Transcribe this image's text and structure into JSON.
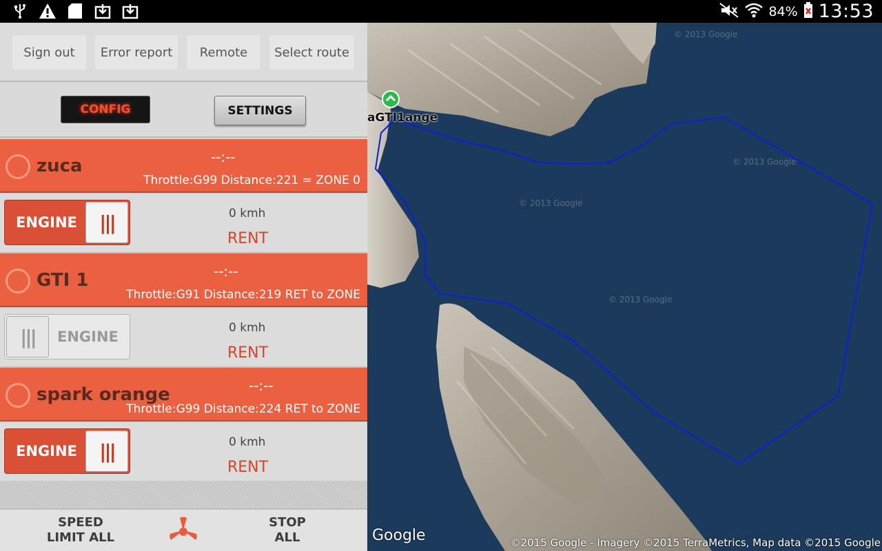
{
  "status_bar": {
    "icons": [
      "usb-icon",
      "warning-icon",
      "sd-card-icon",
      "download-icon",
      "download-icon"
    ],
    "battery_percent": "84%",
    "time": "13:53"
  },
  "toolbar": {
    "sign_out": "Sign out",
    "error_report": "Error report",
    "remote": "Remote",
    "select_route": "Select route"
  },
  "config": {
    "config_label": "CONFIG",
    "settings_label": "SETTINGS"
  },
  "vehicles": [
    {
      "name": "zuca",
      "time": "--:--",
      "throttle": "Throttle:G99 Distance:221 = ZONE 0",
      "engine_label": "ENGINE",
      "engine_on": true,
      "speed": "0 kmh",
      "status": "RENT"
    },
    {
      "name": "GTI 1",
      "time": "--:--",
      "throttle": "Throttle:G91 Distance:219 RET to ZONE",
      "engine_label": "ENGINE",
      "engine_on": false,
      "speed": "0 kmh",
      "status": "RENT"
    },
    {
      "name": "spark orange",
      "time": "--:--",
      "throttle": "Throttle:G99 Distance:224 RET to ZONE",
      "engine_label": "ENGINE",
      "engine_on": true,
      "speed": "0 kmh",
      "status": "RENT"
    }
  ],
  "bottom_bar": {
    "speed_limit_line1": "SPEED",
    "speed_limit_line2": "LIMIT ALL",
    "center_icon": "propeller-icon",
    "stop_line1": "STOP",
    "stop_line2": "ALL"
  },
  "map": {
    "marker_label": "aGTI1ange",
    "logo": "Google",
    "attribution": "©2015 Google - Imagery ©2015 TerraMetrics, Map data ©2015 Google",
    "watermark": "© 2013 Google",
    "zone_color": "#0a1fd6"
  }
}
